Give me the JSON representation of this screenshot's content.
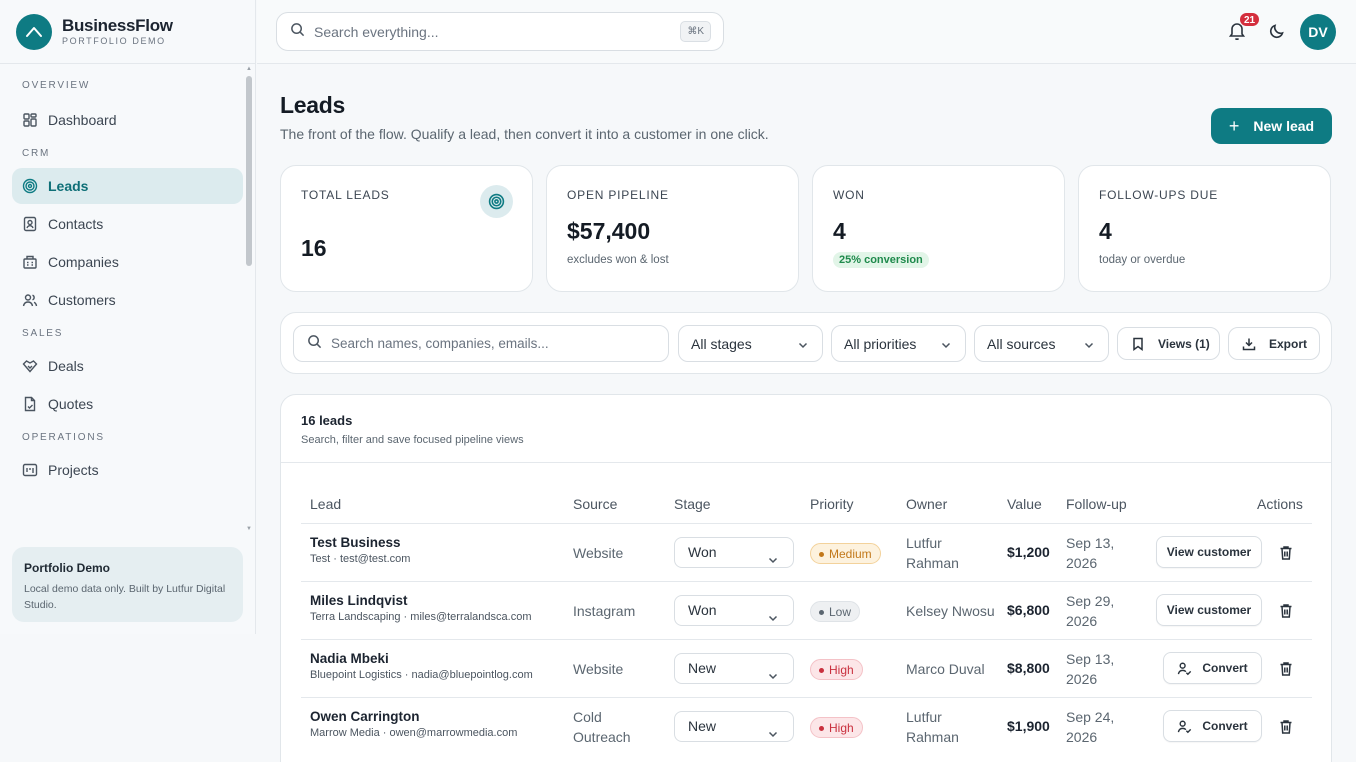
{
  "brand": {
    "name": "BusinessFlow",
    "subtitle": "PORTFOLIO DEMO"
  },
  "sidebar": {
    "sections": [
      {
        "label": "OVERVIEW",
        "items": [
          {
            "label": "Dashboard",
            "icon": "grid-icon"
          }
        ]
      },
      {
        "label": "CRM",
        "items": [
          {
            "label": "Leads",
            "icon": "target-icon",
            "active": true
          },
          {
            "label": "Contacts",
            "icon": "contact-icon"
          },
          {
            "label": "Companies",
            "icon": "building-icon"
          },
          {
            "label": "Customers",
            "icon": "users-icon"
          }
        ]
      },
      {
        "label": "SALES",
        "items": [
          {
            "label": "Deals",
            "icon": "handshake-icon"
          },
          {
            "label": "Quotes",
            "icon": "document-icon"
          }
        ]
      },
      {
        "label": "OPERATIONS",
        "items": [
          {
            "label": "Projects",
            "icon": "kanban-icon"
          }
        ]
      }
    ],
    "promo": {
      "title": "Portfolio Demo",
      "text": "Local demo data only. Built by Lutfur Digital Studio."
    }
  },
  "topbar": {
    "search_placeholder": "Search everything...",
    "shortcut": "⌘K",
    "notifications_count": "21",
    "avatar_initials": "DV"
  },
  "header": {
    "title": "Leads",
    "subtitle": "The front of the flow. Qualify a lead, then convert it into a customer in one click.",
    "new_button": "New lead"
  },
  "stats": [
    {
      "label": "TOTAL LEADS",
      "value": "16",
      "note": ""
    },
    {
      "label": "OPEN PIPELINE",
      "value": "$57,400",
      "note": "excludes won & lost"
    },
    {
      "label": "WON",
      "value": "4",
      "pill": "25% conversion"
    },
    {
      "label": "FOLLOW-UPS DUE",
      "value": "4",
      "note": "today or overdue"
    }
  ],
  "filters": {
    "search_placeholder": "Search names, companies, emails...",
    "stage": "All stages",
    "priority": "All priorities",
    "source": "All sources",
    "views": "Views (1)",
    "export": "Export"
  },
  "table": {
    "title": "16 leads",
    "subtitle": "Search, filter and save focused pipeline views",
    "columns": [
      "Lead",
      "Source",
      "Stage",
      "Priority",
      "Owner",
      "Value",
      "Follow-up",
      "Actions"
    ],
    "rows": [
      {
        "name": "Test Business",
        "sub": "Test · test@test.com",
        "source_1": "Website",
        "source_2": "",
        "stage": "Won",
        "priority": "Medium",
        "priority_level": "medium",
        "owner_1": "Lutfur",
        "owner_2": "Rahman",
        "value": "$1,200",
        "follow_1": "Sep 13,",
        "follow_2": "2026",
        "action": "View customer"
      },
      {
        "name": "Miles Lindqvist",
        "sub": "Terra Landscaping · miles@terralandsca.com",
        "source_1": "Instagram",
        "source_2": "",
        "stage": "Won",
        "priority": "Low",
        "priority_level": "low",
        "owner_1": "Kelsey Nwosu",
        "owner_2": "",
        "value": "$6,800",
        "follow_1": "Sep 29,",
        "follow_2": "2026",
        "action": "View customer"
      },
      {
        "name": "Nadia Mbeki",
        "sub": "Bluepoint Logistics · nadia@bluepointlog.com",
        "source_1": "Website",
        "source_2": "",
        "stage": "New",
        "priority": "High",
        "priority_level": "high",
        "owner_1": "Marco Duval",
        "owner_2": "",
        "value": "$8,800",
        "follow_1": "Sep 13,",
        "follow_2": "2026",
        "action": "Convert"
      },
      {
        "name": "Owen Carrington",
        "sub": "Marrow Media · owen@marrowmedia.com",
        "source_1": "Cold",
        "source_2": "Outreach",
        "stage": "New",
        "priority": "High",
        "priority_level": "high",
        "owner_1": "Lutfur",
        "owner_2": "Rahman",
        "value": "$1,900",
        "follow_1": "Sep 24,",
        "follow_2": "2026",
        "action": "Convert"
      }
    ]
  },
  "colors": {
    "accent": "#0e7b83",
    "danger": "#d42e3d"
  }
}
